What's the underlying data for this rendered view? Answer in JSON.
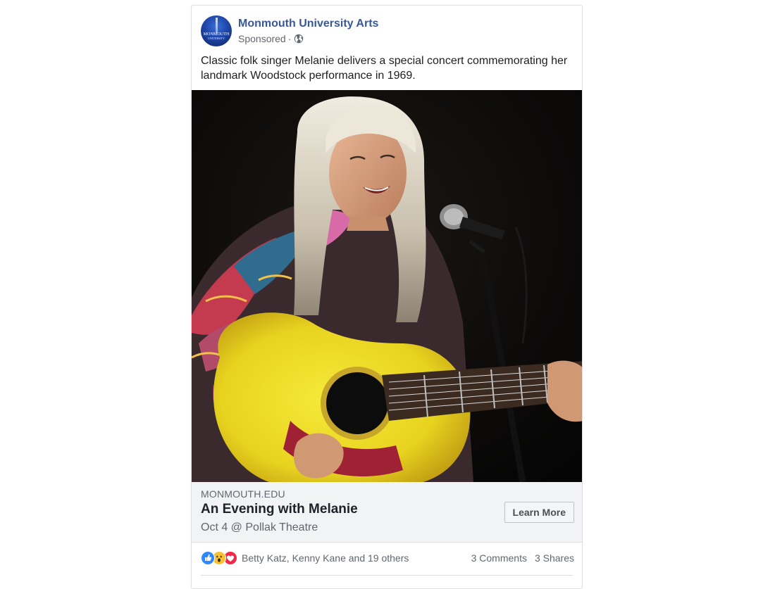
{
  "post": {
    "page_name": "Monmouth University Arts",
    "avatar_text": "MONMOUTH",
    "avatar_subtext": "UNIVERSITY",
    "sponsored_label": "Sponsored",
    "separator": "·",
    "privacy_icon": "globe-icon",
    "text": "Classic folk singer Melanie delivers a special concert commemorating her landmark Woodstock performance in 1969."
  },
  "link": {
    "domain": "MONMOUTH.EDU",
    "title": "An Evening with Melanie",
    "description": "Oct 4 @ Pollak Theatre",
    "cta_label": "Learn More"
  },
  "engagement": {
    "reaction_icons": [
      "like-icon",
      "wow-icon",
      "love-icon"
    ],
    "reaction_names": "Betty Katz, Kenny Kane and 19 others",
    "comments": "3 Comments",
    "shares": "3 Shares"
  },
  "colors": {
    "page_name": "#385898",
    "like": "#2d88ff",
    "wow": "#f7c232",
    "love": "#f02849",
    "link_bar_bg": "#f2f3f5"
  }
}
